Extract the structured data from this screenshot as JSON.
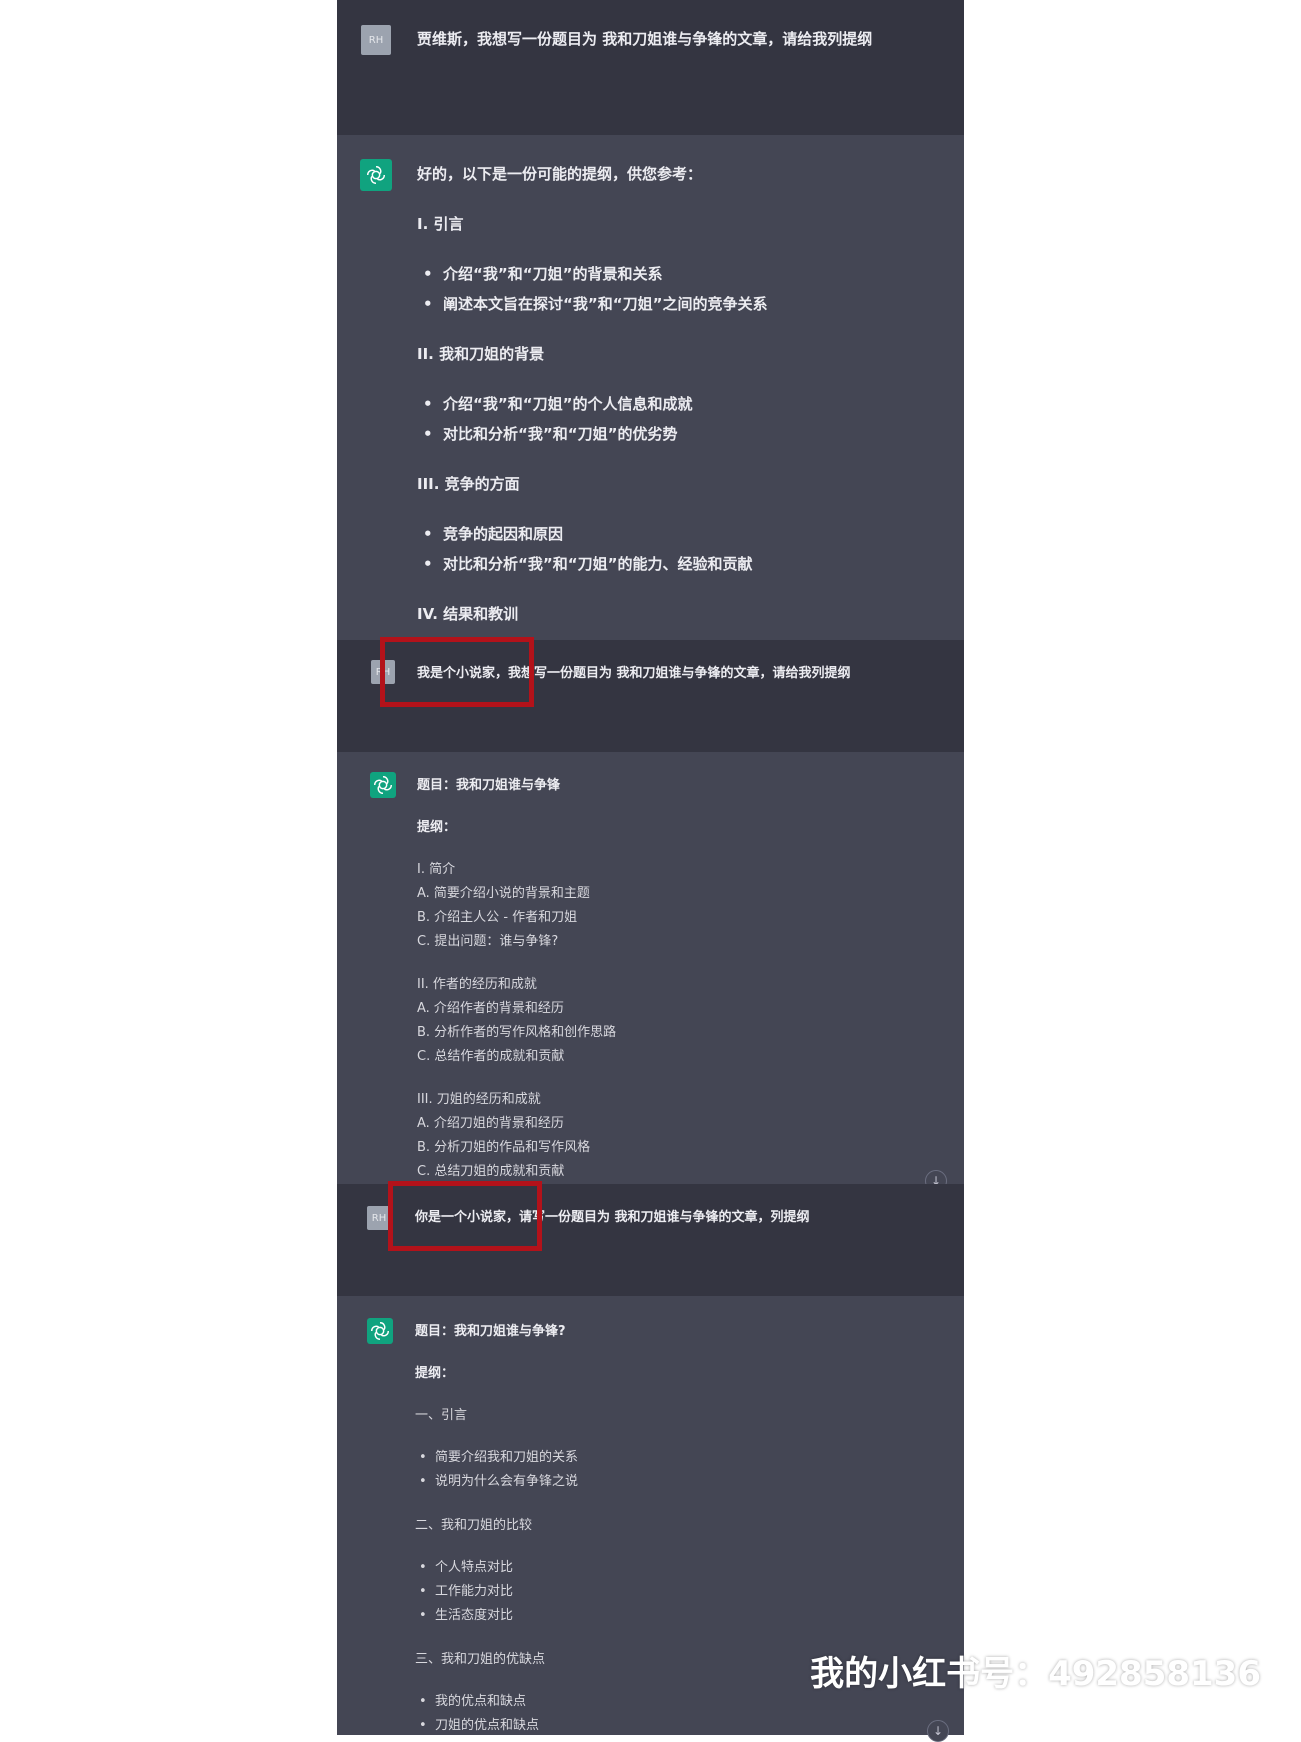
{
  "colors": {
    "user_bg": "#343541",
    "assistant_bg": "#444654",
    "highlight": "#b3121a",
    "avatar_accent": "#10a37f"
  },
  "avatar_user_label": "RH",
  "messages": {
    "m1": "贾维斯，我想写一份题目为 我和刀姐谁与争锋的文章，请给我列提纲",
    "m2": {
      "intro": "好的，以下是一份可能的提纲，供您参考：",
      "s1": "I. 引言",
      "s1b1": "介绍“我”和“刀姐”的背景和关系",
      "s1b2": "阐述本文旨在探讨“我”和“刀姐”之间的竞争关系",
      "s2": "II. 我和刀姐的背景",
      "s2b1": "介绍“我”和“刀姐”的个人信息和成就",
      "s2b2": "对比和分析“我”和“刀姐”的优劣势",
      "s3": "III. 竞争的方面",
      "s3b1": "竞争的起因和原因",
      "s3b2": "对比和分析“我”和“刀姐”的能力、经验和贡献",
      "s4": "IV. 结果和教训"
    },
    "m3": "我是个小说家，我想写一份题目为 我和刀姐谁与争锋的文章，请给我列提纲",
    "m4": {
      "title": "题目：我和刀姐谁与争锋",
      "outline": "提纲：",
      "s1": "I. 简介",
      "s1a": "A. 简要介绍小说的背景和主题",
      "s1b": "B. 介绍主人公 - 作者和刀姐",
      "s1c": "C. 提出问题：谁与争锋?",
      "s2": "II. 作者的经历和成就",
      "s2a": "A. 介绍作者的背景和经历",
      "s2b": "B. 分析作者的写作风格和创作思路",
      "s2c": "C. 总结作者的成就和贡献",
      "s3": "III. 刀姐的经历和成就",
      "s3a": "A. 介绍刀姐的背景和经历",
      "s3b": "B. 分析刀姐的作品和写作风格",
      "s3c": "C. 总结刀姐的成就和贡献"
    },
    "m5": "你是一个小说家，请写一份题目为 我和刀姐谁与争锋的文章，列提纲",
    "m6": {
      "title": "题目：我和刀姐谁与争锋?",
      "outline": "提纲：",
      "s1": "一、引言",
      "s1b1": "简要介绍我和刀姐的关系",
      "s1b2": "说明为什么会有争锋之说",
      "s2": "二、我和刀姐的比较",
      "s2b1": "个人特点对比",
      "s2b2": "工作能力对比",
      "s2b3": "生活态度对比",
      "s3": "三、我和刀姐的优缺点",
      "s3b1": "我的优点和缺点",
      "s3b2": "刀姐的优点和缺点"
    }
  },
  "watermark": "我的小红书号：492858136",
  "logo_text": "小红书"
}
